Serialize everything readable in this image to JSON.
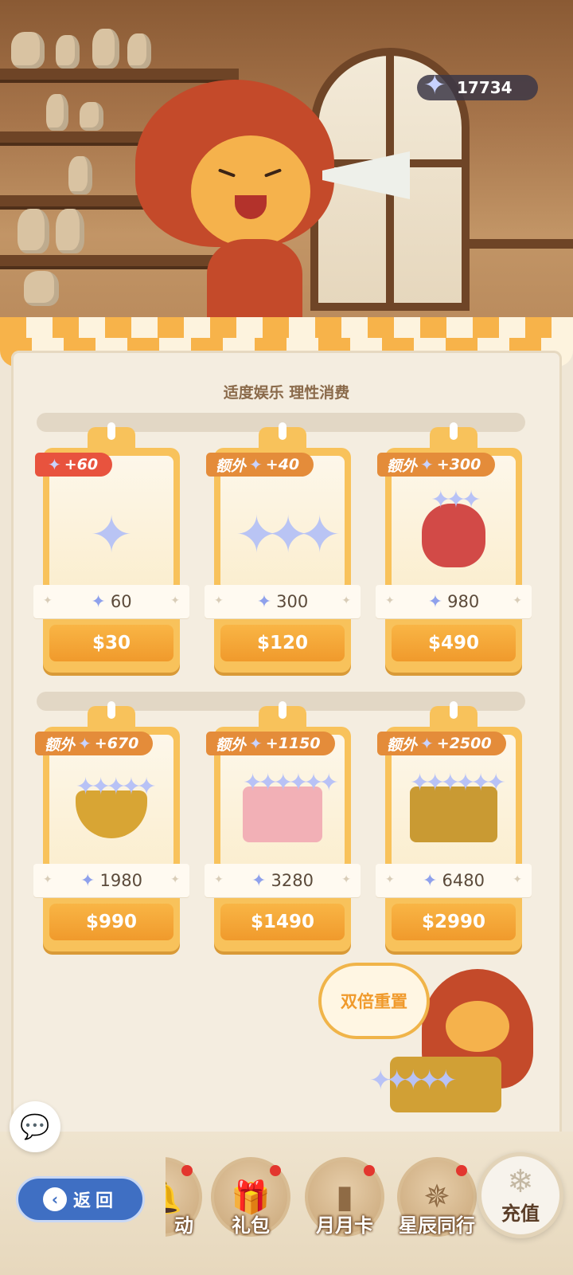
{
  "balance": {
    "value": "17734",
    "icon": "star-gem-icon"
  },
  "notice": "适度娱乐 理性消费",
  "row1": [
    {
      "badge_prefix": "",
      "badge_bonus": "+60",
      "badge_color": "#e8533e",
      "amount": "60",
      "price": "$30",
      "art": "single-gem"
    },
    {
      "badge_prefix": "额外",
      "badge_bonus": "+40",
      "badge_color": "#e48c3a",
      "amount": "300",
      "price": "$120",
      "art": "three-gems"
    },
    {
      "badge_prefix": "额外",
      "badge_bonus": "+300",
      "badge_color": "#e48c3a",
      "amount": "980",
      "price": "$490",
      "art": "gem-bag"
    }
  ],
  "row2": [
    {
      "badge_prefix": "额外",
      "badge_bonus": "+670",
      "badge_color": "#e48c3a",
      "amount": "1980",
      "price": "$990",
      "art": "gem-chalice"
    },
    {
      "badge_prefix": "额外",
      "badge_bonus": "+1150",
      "badge_color": "#e48c3a",
      "amount": "3280",
      "price": "$1490",
      "art": "gem-giftbox"
    },
    {
      "badge_prefix": "额外",
      "badge_bonus": "+2500",
      "badge_color": "#e48c3a",
      "amount": "6480",
      "price": "$2990",
      "art": "gem-chest"
    }
  ],
  "promo": {
    "label": "双倍重置"
  },
  "nav": {
    "back": "返回",
    "items": [
      {
        "label": "动",
        "badge": true
      },
      {
        "label": "礼包",
        "badge": true
      },
      {
        "label": "月月卡",
        "badge": true
      },
      {
        "label": "星辰同行",
        "badge": true
      }
    ],
    "recharge": "充值"
  },
  "colors": {
    "accent": "#f09a2c",
    "card": "#f8c25b",
    "back_button": "#3f6fc3",
    "badge_dot": "#e3362e"
  }
}
